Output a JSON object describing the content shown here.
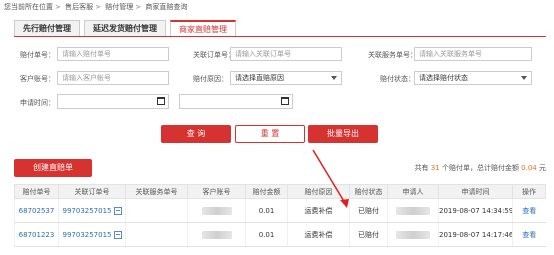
{
  "breadcrumb": [
    "您当前所在位置",
    "售后客服",
    "赔付管理",
    "商家直赔查询"
  ],
  "tabs": [
    {
      "label": "先行赔付管理",
      "active": false
    },
    {
      "label": "延迟发货赔付管理",
      "active": false
    },
    {
      "label": "商家直赔管理",
      "active": true
    }
  ],
  "filters": {
    "claim_no": {
      "label": "赔付单号：",
      "placeholder": "请输入赔付单号"
    },
    "order_no": {
      "label": "关联订单号：",
      "placeholder": "请输入关联订单号"
    },
    "service_no": {
      "label": "关联服务单号：",
      "placeholder": "请输入关联服务单号"
    },
    "account_no": {
      "label": "客户账号：",
      "placeholder": "请输入客户帐号"
    },
    "reason": {
      "label": "赔付原因：",
      "value": "请选择直赔原因"
    },
    "status": {
      "label": "赔付状态：",
      "value": "请选择赔付状态"
    },
    "apply_time": {
      "label": "申请时间："
    }
  },
  "buttons": {
    "query": "查 询",
    "reset": "重 置",
    "export": "批量导出",
    "create": "创建直赔单"
  },
  "summary": {
    "prefix": "共有 ",
    "count": "31",
    "mid": " 个赔付单，总计赔付金额 ",
    "amount": "0.04",
    "suffix": " 元"
  },
  "table": {
    "headers": [
      "赔付单号",
      "关联订单号",
      "关联服务单号",
      "客户账号",
      "赔付金额",
      "赔付原因",
      "赔付状态",
      "申请人",
      "申请时间",
      "操作"
    ],
    "rows": [
      {
        "claim_no": "68702537",
        "order_no": "99703257015",
        "service_no": "",
        "amount": "0.01",
        "reason": "运费补偿",
        "status": "已赔付",
        "time": "2019-08-07 14:34:59",
        "action": "查看"
      },
      {
        "claim_no": "68701223",
        "order_no": "99703257015",
        "service_no": "",
        "amount": "0.01",
        "reason": "运费补偿",
        "status": "已赔付",
        "time": "2019-08-07 14:17:46",
        "action": "查看"
      }
    ]
  },
  "colors": {
    "accent": "#d63230",
    "link": "#2a6fbe",
    "highlight": "#e8731b"
  }
}
